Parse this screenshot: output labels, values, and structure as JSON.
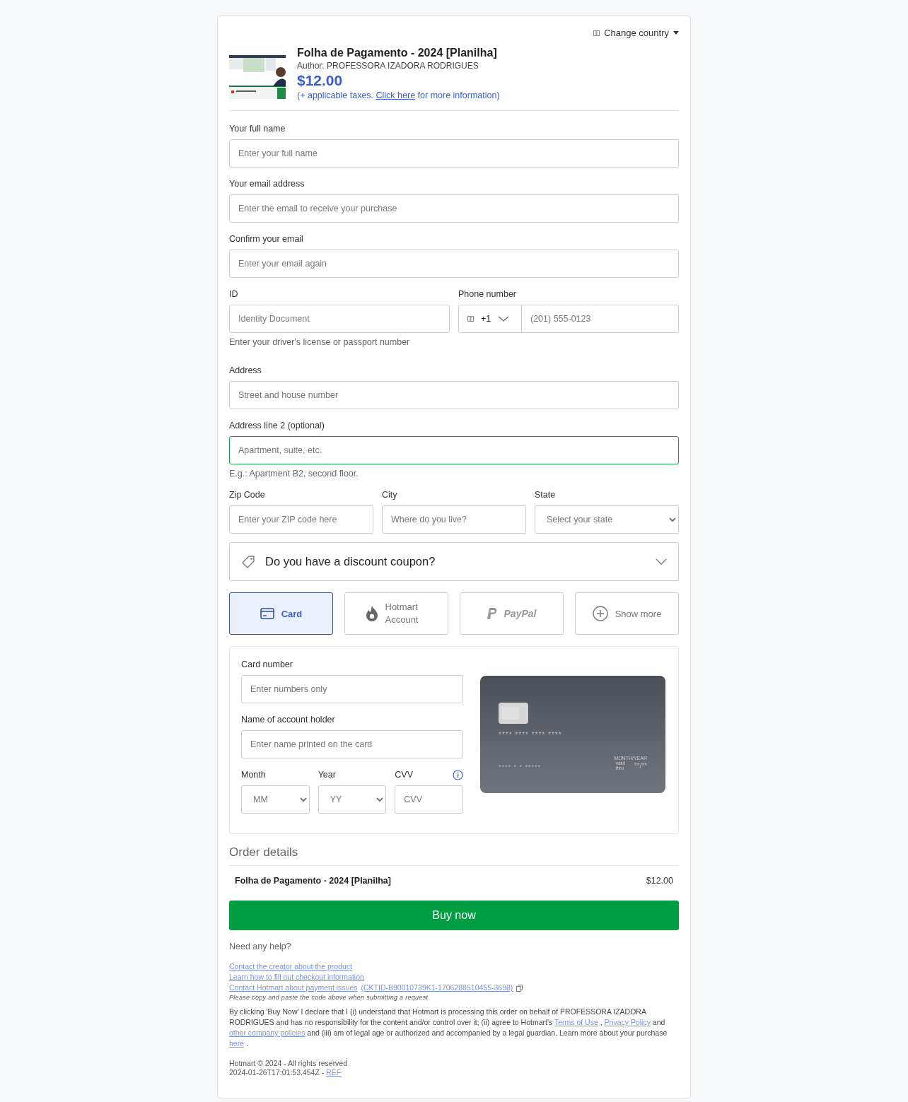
{
  "header": {
    "change_country": "Change country"
  },
  "product": {
    "title": "Folha de Pagamento - 2024 [Planilha]",
    "author": "Author: PROFESSORA IZADORA RODRIGUES",
    "price": "$12.00",
    "taxes_before": "(+ applicable taxes.",
    "taxes_link": "Click here",
    "taxes_after": "for more information)"
  },
  "contact_fields": [
    {
      "label": "Your full name",
      "placeholder": "Enter your full name"
    },
    {
      "label": "Your email address",
      "placeholder": "Enter the email to receive your purchase"
    },
    {
      "label": "Confirm your email",
      "placeholder": "Enter your email again"
    }
  ],
  "id_field": {
    "label": "ID",
    "placeholder": "Identity Document",
    "hint": "Enter your driver's license or passport number"
  },
  "phone": {
    "label": "Phone number",
    "code": "+1",
    "placeholder": "(201) 555-0123"
  },
  "address": {
    "label": "Address",
    "placeholder": "Street and house number"
  },
  "address2": {
    "label": "Address line 2 (optional)",
    "placeholder": "Apartment, suite, etc.",
    "hint": "E.g.: Apartment B2, second floor.",
    "focused": true
  },
  "location_fields": [
    {
      "kind": "input",
      "label": "Zip Code",
      "placeholder": "Enter your ZIP code here"
    },
    {
      "kind": "input",
      "label": "City",
      "placeholder": "Where do you live?"
    },
    {
      "kind": "select",
      "label": "State",
      "placeholder": "Select your state"
    }
  ],
  "coupon": {
    "label": "Do you have a discount coupon?",
    "expanded": false
  },
  "payment_methods": [
    {
      "kind": "card",
      "label": "Card",
      "selected": true
    },
    {
      "kind": "hotmart",
      "label": "Hotmart Account",
      "selected": false
    },
    {
      "kind": "paypal",
      "label": "PayPal",
      "selected": false
    },
    {
      "kind": "more",
      "label": "Show more",
      "selected": false
    }
  ],
  "card_form": {
    "number": {
      "label": "Card number",
      "placeholder": "Enter numbers only"
    },
    "holder": {
      "label": "Name of account holder",
      "placeholder": "Enter name printed on the card"
    },
    "month": {
      "label": "Month",
      "placeholder": "MM"
    },
    "year": {
      "label": "Year",
      "placeholder": "YY"
    },
    "cvv": {
      "label": "CVV",
      "placeholder": "CVV"
    }
  },
  "card_preview": {
    "number": "**** **** **** ****",
    "name": "**** * * *****",
    "expiry_label": "MONTH/YEAR",
    "valid": "valid thru",
    "expiry": "**/**"
  },
  "order": {
    "title": "Order details",
    "items": [
      {
        "name": "Folha de Pagamento - 2024 [Planilha]",
        "price": "$12.00"
      }
    ]
  },
  "buy_button": "Buy now",
  "help": {
    "title": "Need any help?",
    "links": [
      "Contact the creator about the product",
      "Learn how to fill out checkout information",
      "Contact Hotmart about payment issues"
    ],
    "code": "(CKTID-B90010739K1-1706288510455-3698)",
    "note": "Please copy and paste the code above when submitting a request"
  },
  "legal": [
    {
      "kind": "text",
      "text": "By clicking 'Buy Now' I declare that I (i) understand that Hotmart is processing this order on behalf of PROFESSORA IZADORA RODRIGUES and has no responsibility for the content and/or control over it; (ii) agree to Hotmart's "
    },
    {
      "kind": "link",
      "text": "Terms of Use"
    },
    {
      "kind": "text",
      "text": " , "
    },
    {
      "kind": "link",
      "text": "Privacy Policy"
    },
    {
      "kind": "text",
      "text": " and "
    },
    {
      "kind": "link",
      "text": "other company policies"
    },
    {
      "kind": "text",
      "text": " and (iii) am of legal age or authorized and accompanied by a legal guardian. Learn more about your purchase "
    },
    {
      "kind": "link",
      "text": "here"
    },
    {
      "kind": "text",
      "text": " ."
    }
  ],
  "footer": {
    "copyright": "Hotmart © 2024 - All rights reserved",
    "timestamp": "2024-01-26T17:01:53.454Z -",
    "ref": "REF"
  }
}
